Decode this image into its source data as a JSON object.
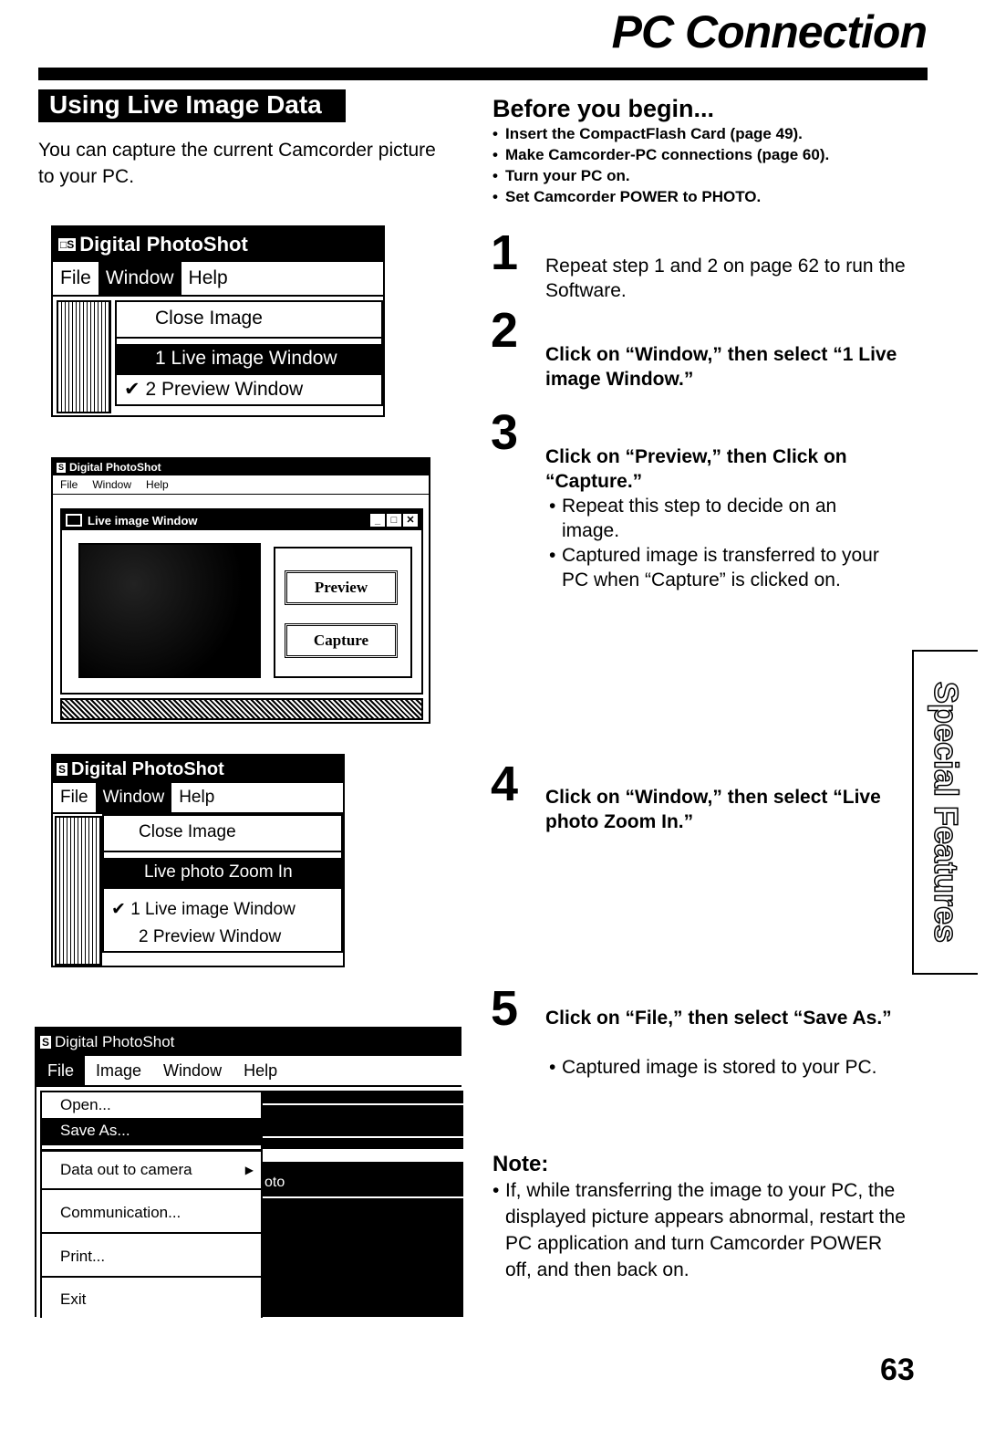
{
  "header": {
    "title": "PC Connection"
  },
  "section": {
    "title": "Using Live Image Data",
    "intro": "You can capture the current Camcorder picture to your PC."
  },
  "screens": {
    "s1": {
      "app_title": "Digital PhotoShot",
      "menu": [
        "File",
        "Window",
        "Help"
      ],
      "selected_menu": "Window",
      "dropdown": [
        {
          "label": "Close Image",
          "selected": false,
          "checked": false
        },
        {
          "label": "1 Live image Window",
          "selected": true,
          "checked": false
        },
        {
          "label": "2 Preview Window",
          "selected": false,
          "checked": true
        }
      ]
    },
    "s2": {
      "app_title": "Digital PhotoShot",
      "menu": [
        "File",
        "Window",
        "Help"
      ],
      "child_title": "Live image Window",
      "preview_button": "Preview",
      "capture_button": "Capture"
    },
    "s3": {
      "app_title": "Digital PhotoShot",
      "menu": [
        "File",
        "Window",
        "Help"
      ],
      "selected_menu": "Window",
      "dropdown": [
        {
          "label": "Close Image",
          "selected": false,
          "checked": false
        },
        {
          "label": "Live photo Zoom In",
          "selected": true,
          "checked": false
        },
        {
          "label": "1 Live image Window",
          "selected": false,
          "checked": true
        },
        {
          "label": "2 Preview Window",
          "selected": false,
          "checked": false
        }
      ]
    },
    "s4": {
      "app_title": "Digital PhotoShot",
      "menu": [
        "File",
        "Image",
        "Window",
        "Help"
      ],
      "selected_menu": "File",
      "dropdown": [
        {
          "label": "Open...",
          "selected": false
        },
        {
          "label": "Save As...",
          "selected": true
        },
        {
          "label": "Data out to camera",
          "selected": false,
          "submenu": true
        },
        {
          "label": "Communication...",
          "selected": false
        },
        {
          "label": "Print...",
          "selected": false
        },
        {
          "label": "Exit",
          "selected": false
        }
      ],
      "background_fragment": "oto"
    }
  },
  "before": {
    "title": "Before you begin...",
    "items": [
      "Insert the CompactFlash Card (page 49).",
      "Make Camcorder-PC connections (page 60).",
      "Turn your PC on.",
      "Set Camcorder POWER to PHOTO."
    ]
  },
  "steps": [
    {
      "num": "1",
      "text": "Repeat step 1 and 2 on page 62 to run the Software.",
      "bold": false,
      "bullets": []
    },
    {
      "num": "2",
      "text": "Click on “Window,” then select “1 Live image Window.”",
      "bold": true,
      "bullets": []
    },
    {
      "num": "3",
      "text": "Click on “Preview,” then Click on “Capture.”",
      "bold": true,
      "bullets": [
        "Repeat this step to decide on an image.",
        "Captured image is transferred to your PC when “Capture” is clicked on."
      ]
    },
    {
      "num": "4",
      "text": "Click on “Window,” then select “Live photo Zoom In.”",
      "bold": true,
      "bullets": []
    },
    {
      "num": "5",
      "text": "Click on “File,” then select “Save As.”",
      "bold": true,
      "bullets": [
        "Captured image is stored to your PC."
      ]
    }
  ],
  "note": {
    "title": "Note:",
    "items": [
      "If, while transferring the image to your PC, the displayed picture appears abnormal, restart the PC application and turn Camcorder POWER off, and then back on."
    ]
  },
  "side_tab": "Special Features",
  "page_number": "63"
}
